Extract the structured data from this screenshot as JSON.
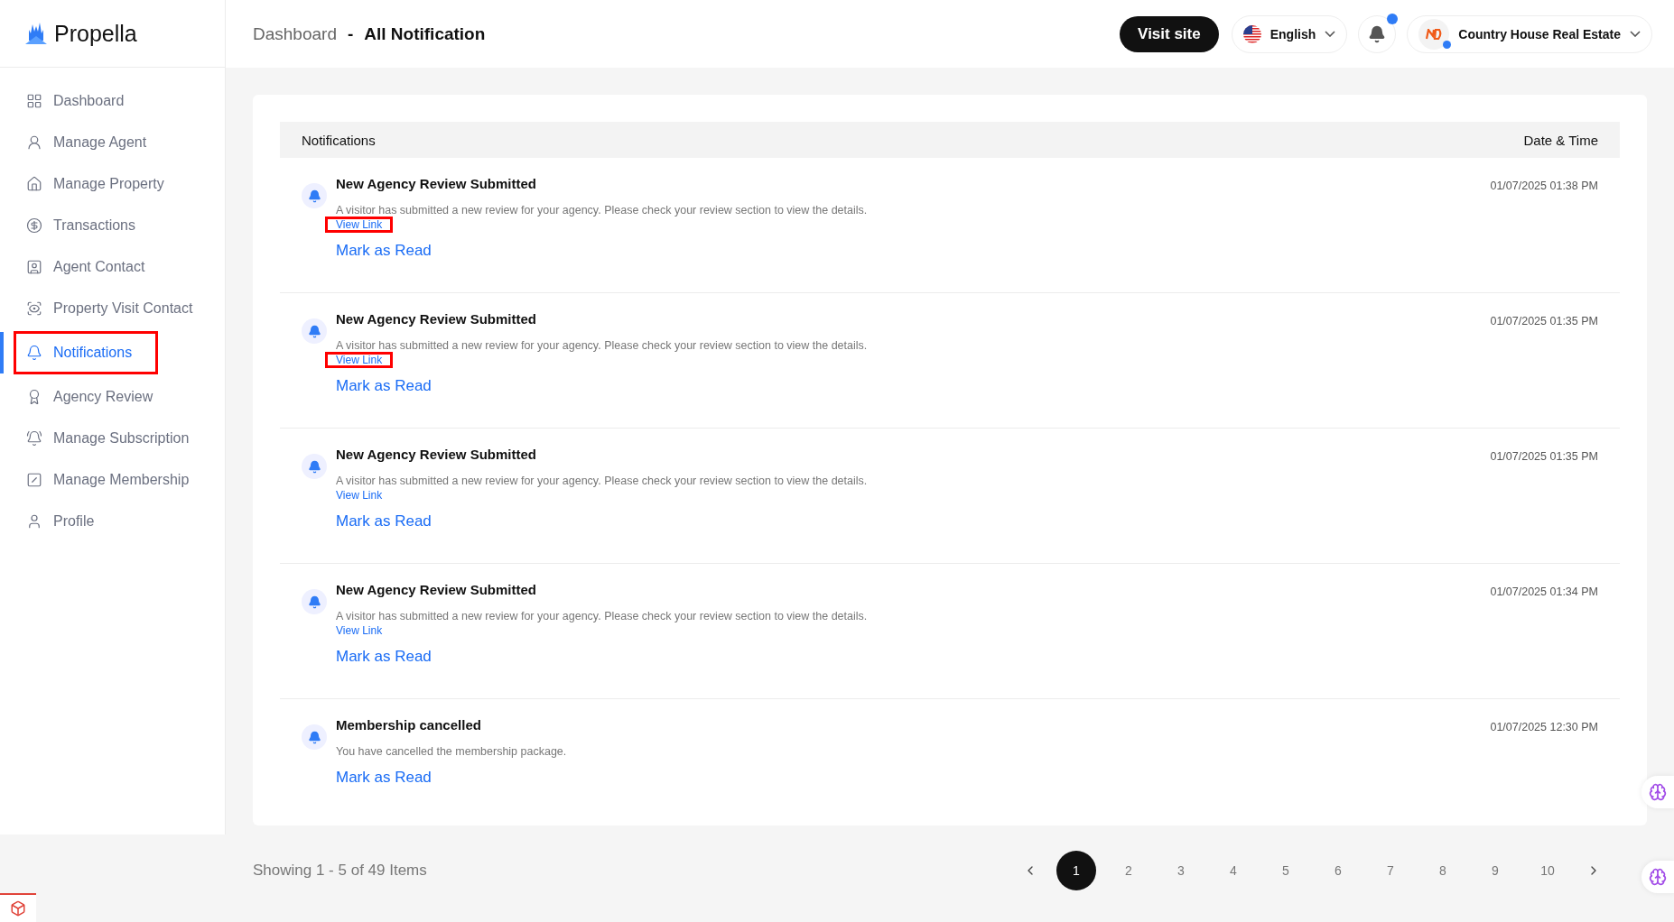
{
  "brand": {
    "name": "Propella"
  },
  "sidebar": {
    "items": [
      {
        "label": "Dashboard",
        "selected": false,
        "highlighted": false
      },
      {
        "label": "Manage Agent",
        "selected": false,
        "highlighted": false
      },
      {
        "label": "Manage Property",
        "selected": false,
        "highlighted": false
      },
      {
        "label": "Transactions",
        "selected": false,
        "highlighted": false
      },
      {
        "label": "Agent Contact",
        "selected": false,
        "highlighted": false
      },
      {
        "label": "Property Visit Contact",
        "selected": false,
        "highlighted": false
      },
      {
        "label": "Notifications",
        "selected": true,
        "highlighted": true
      },
      {
        "label": "Agency Review",
        "selected": false,
        "highlighted": false
      },
      {
        "label": "Manage Subscription",
        "selected": false,
        "highlighted": false
      },
      {
        "label": "Manage Membership",
        "selected": false,
        "highlighted": false
      },
      {
        "label": "Profile",
        "selected": false,
        "highlighted": false
      }
    ]
  },
  "header": {
    "breadcrumb": [
      "Dashboard",
      "All Notification"
    ],
    "separator": "-",
    "visit_button": "Visit site",
    "language": "English",
    "bell_unread": true,
    "account": {
      "name": "Country House Real Estate",
      "online": true
    }
  },
  "table": {
    "columns": [
      "Notifications",
      "Date & Time"
    ],
    "rows": [
      {
        "title": "New Agency Review Submitted",
        "message": "A visitor has submitted a new review for your agency. Please check your review section to view the details.",
        "link": "View Link",
        "link_highlighted": true,
        "time": "01/07/2025 01:38 PM",
        "action": "Mark as Read"
      },
      {
        "title": "New Agency Review Submitted",
        "message": "A visitor has submitted a new review for your agency. Please check your review section to view the details.",
        "link": "View Link",
        "link_highlighted": true,
        "time": "01/07/2025 01:35 PM",
        "action": "Mark as Read"
      },
      {
        "title": "New Agency Review Submitted",
        "message": "A visitor has submitted a new review for your agency. Please check your review section to view the details.",
        "link": "View Link",
        "link_highlighted": false,
        "time": "01/07/2025 01:35 PM",
        "action": "Mark as Read"
      },
      {
        "title": "New Agency Review Submitted",
        "message": "A visitor has submitted a new review for your agency. Please check your review section to view the details.",
        "link": "View Link",
        "link_highlighted": false,
        "time": "01/07/2025 01:34 PM",
        "action": "Mark as Read"
      },
      {
        "title": "Membership cancelled",
        "message": "You have cancelled the membership package.",
        "time": "01/07/2025 12:30 PM",
        "action": "Mark as Read"
      }
    ]
  },
  "pagination": {
    "summary": "Showing 1 - 5 of 49 Items",
    "pages": [
      {
        "label": "1",
        "selected": true
      },
      {
        "label": "2",
        "selected": false
      },
      {
        "label": "3",
        "selected": false
      },
      {
        "label": "4",
        "selected": false
      },
      {
        "label": "5",
        "selected": false
      },
      {
        "label": "6",
        "selected": false
      },
      {
        "label": "7",
        "selected": false
      },
      {
        "label": "8",
        "selected": false
      },
      {
        "label": "9",
        "selected": false
      },
      {
        "label": "10",
        "selected": false
      }
    ]
  }
}
